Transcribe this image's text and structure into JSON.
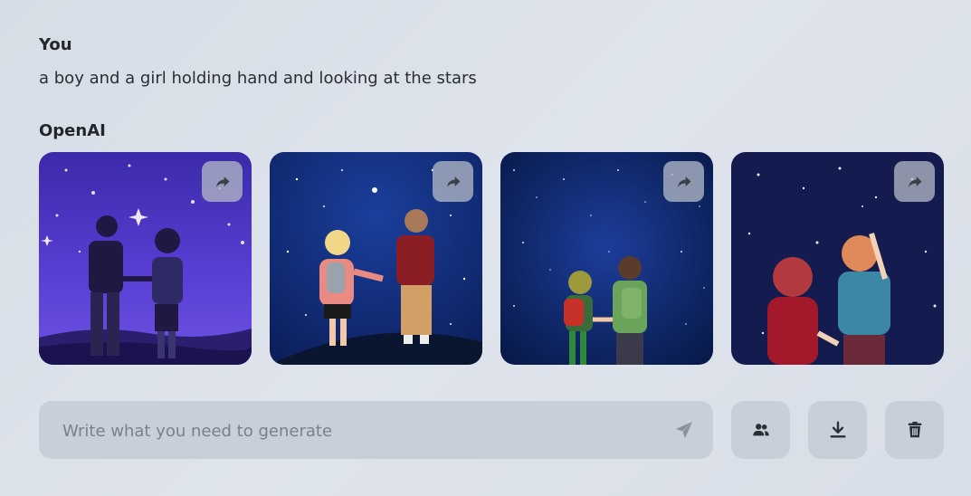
{
  "conversation": {
    "user_name": "You",
    "user_prompt": "a boy and a girl holding hand and looking at the stars",
    "ai_name": "OpenAI",
    "images": [
      {
        "icon": "share-icon"
      },
      {
        "icon": "share-icon"
      },
      {
        "icon": "share-icon"
      },
      {
        "icon": "share-icon"
      }
    ]
  },
  "composer": {
    "placeholder": "Write what you need to generate",
    "value": "",
    "send_icon": "send-icon"
  },
  "actions": [
    {
      "icon": "users-icon"
    },
    {
      "icon": "download-icon"
    },
    {
      "icon": "trash-icon"
    }
  ],
  "colors": {
    "background": "#dbe0e8",
    "button_bg": "#c9cfd8",
    "icon_color": "#2b2f36",
    "share_overlay": "#afb6c4"
  }
}
